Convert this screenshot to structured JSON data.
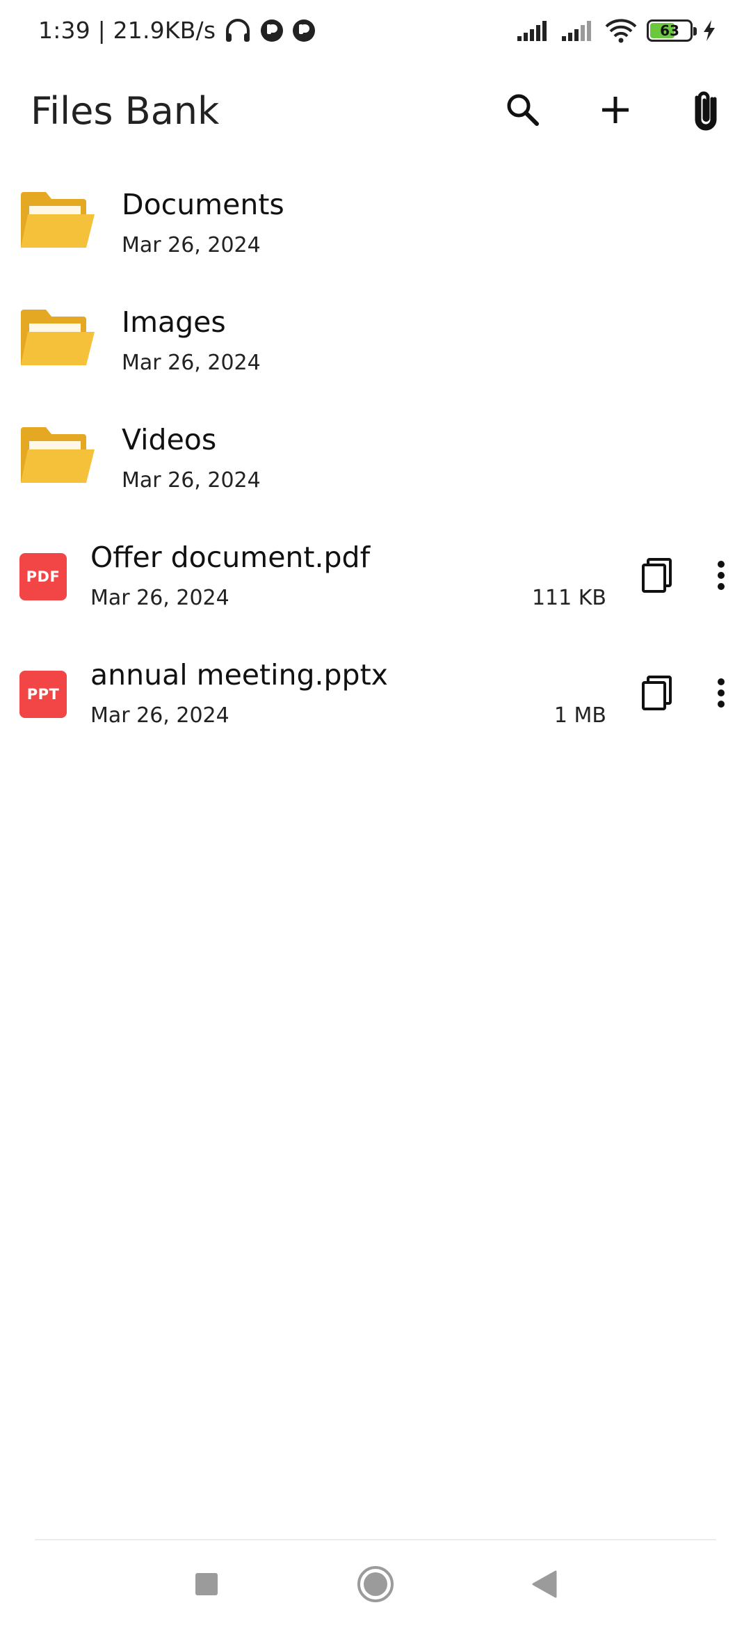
{
  "status_bar": {
    "time_speed": "1:39 | 21.9KB/s",
    "battery_level": "63",
    "battery_fraction": 0.63,
    "battery_color": "#6ac73e",
    "icons": [
      "headphones-icon",
      "notification-app-icon",
      "notification-app-icon",
      "cell-signal-icon",
      "cell-signal-icon",
      "wifi-icon",
      "battery-icon",
      "charging-bolt-icon"
    ]
  },
  "header": {
    "title": "Files Bank",
    "actions": [
      "search-icon",
      "plus-icon",
      "paperclip-icon"
    ]
  },
  "folders": [
    {
      "name": "Documents",
      "date": "Mar 26, 2024"
    },
    {
      "name": "Images",
      "date": "Mar 26, 2024"
    },
    {
      "name": "Videos",
      "date": "Mar 26, 2024"
    }
  ],
  "files": [
    {
      "badge": "PDF",
      "name": "Offer document.pdf",
      "date": "Mar 26, 2024",
      "size": "111 KB"
    },
    {
      "badge": "PPT",
      "name": "annual meeting.pptx",
      "date": "Mar 26, 2024",
      "size": "1 MB"
    }
  ],
  "colors": {
    "folder": "#f5c13a",
    "folder_back": "#e5a823",
    "file_badge": "#f24646"
  },
  "nav": [
    "recents-square-icon",
    "home-circle-icon",
    "back-triangle-icon"
  ]
}
